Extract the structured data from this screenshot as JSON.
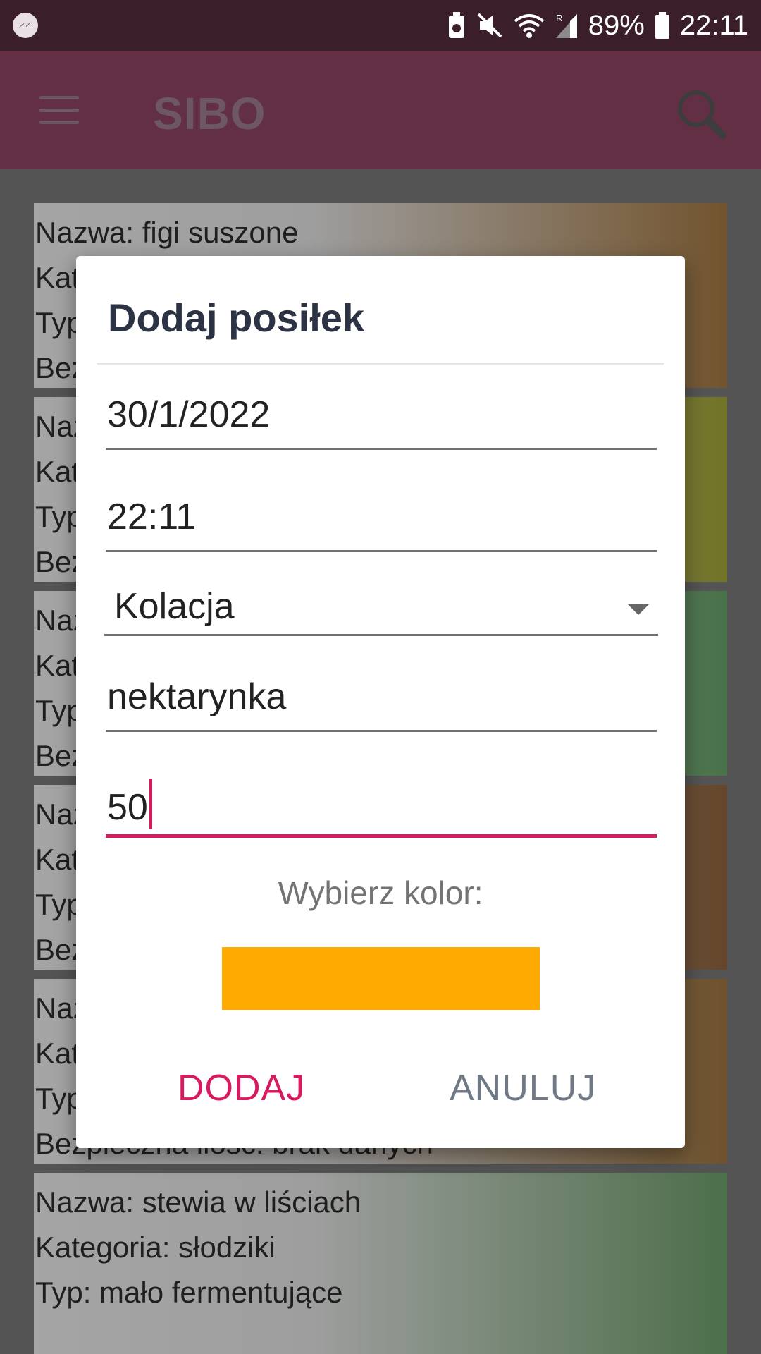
{
  "status_bar": {
    "battery_percent": "89%",
    "time": "22:11",
    "icons": [
      "messenger-icon",
      "battery-saver-icon",
      "mute-icon",
      "wifi-icon",
      "signal-roaming-icon",
      "battery-icon"
    ]
  },
  "app_bar": {
    "title": "SIBO",
    "color": "#622f45"
  },
  "list_items": [
    {
      "lines": [
        "Nazwa: figi suszone",
        "Kategoria: owoce",
        "Typ: wysoko fermentujące",
        "Bezpieczna ilość: brak danych"
      ],
      "color": "#a97c45"
    },
    {
      "lines": [
        "Nazwa:",
        "Kategoria:",
        "Typ:",
        "Bezpieczna ilość:"
      ],
      "color": "#a8ab3a"
    },
    {
      "lines": [
        "Nazwa:",
        "Kategoria:",
        "Typ:",
        "Bezpieczna ilość:"
      ],
      "color": "#6ba86c"
    },
    {
      "lines": [
        "Nazwa:",
        "Kategoria:",
        "Typ:",
        "Bezpieczna ilość:"
      ],
      "color": "#95673f"
    },
    {
      "lines": [
        "Nazwa:",
        "Kategoria:",
        "Typ:",
        "Bezpieczna ilość: brak danych"
      ],
      "color": "#a47942"
    },
    {
      "lines": [
        "Nazwa: stewia w liściach",
        "Kategoria: słodziki",
        "Typ: mało fermentujące",
        ""
      ],
      "color": "#72a46e"
    }
  ],
  "dialog": {
    "title": "Dodaj posiłek",
    "date": "30/1/2022",
    "time": "22:11",
    "meal_type": "Kolacja",
    "food_name": "nektarynka",
    "amount": "50",
    "color_label": "Wybierz kolor:",
    "selected_color": "#ffaa00",
    "add_button": "DODAJ",
    "cancel_button": "ANULUJ"
  }
}
